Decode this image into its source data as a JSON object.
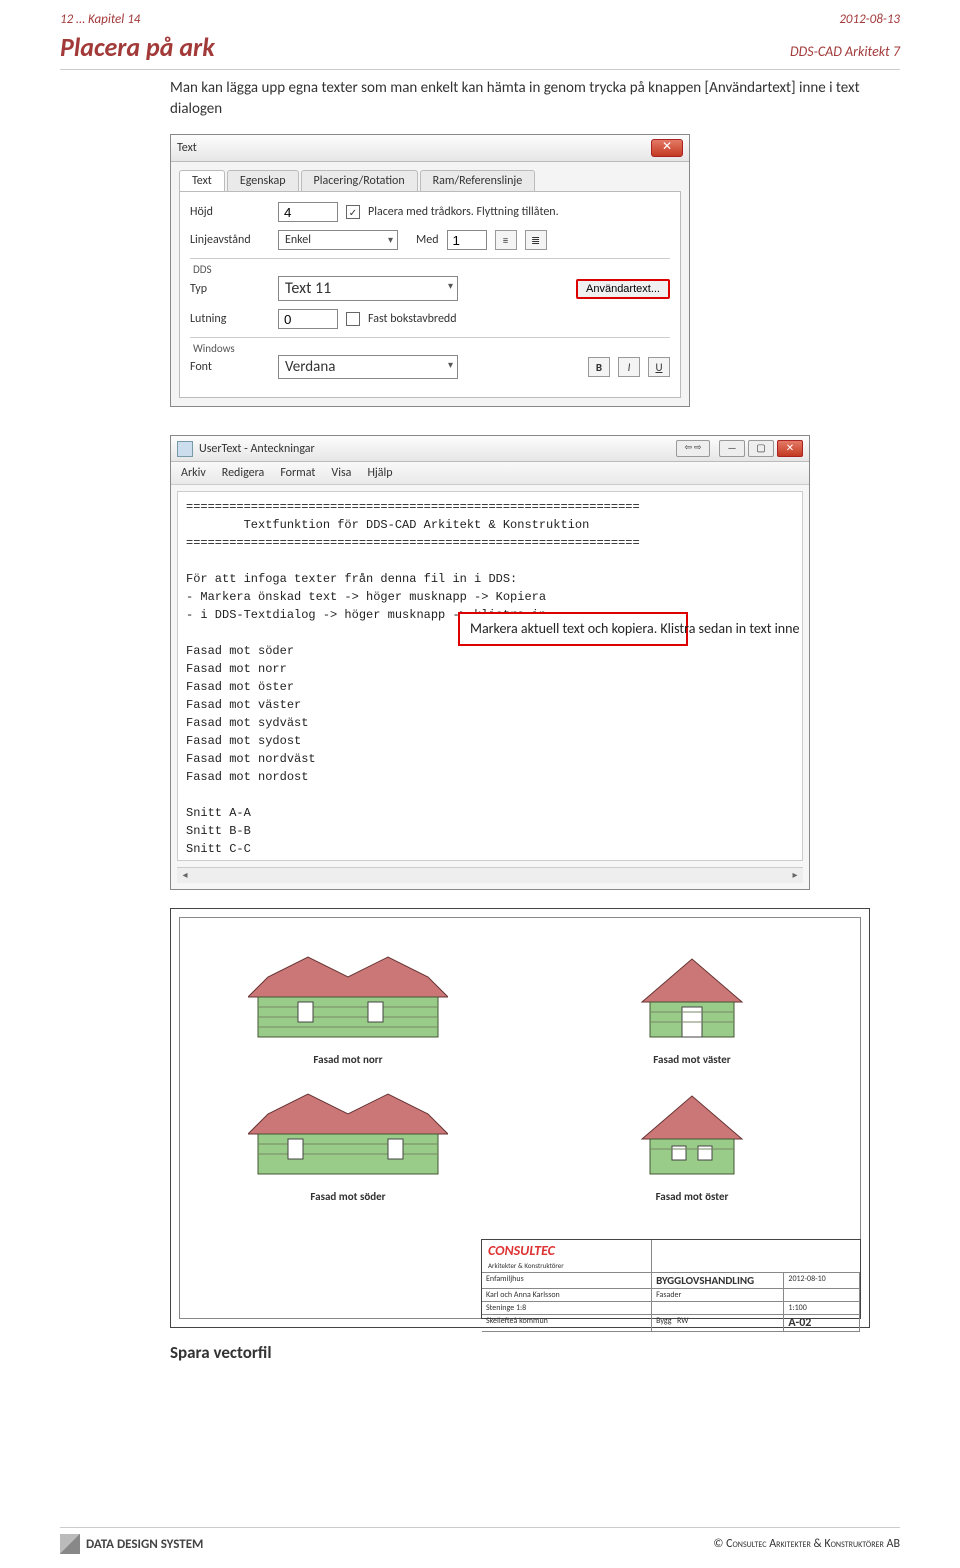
{
  "header": {
    "chapter": "12 … Kapitel 14",
    "date": "2012-08-13"
  },
  "title": {
    "main": "Placera på ark",
    "sub": "DDS-CAD Arkitekt 7"
  },
  "intro": "Man kan lägga upp egna texter som man enkelt kan hämta in genom trycka på knappen [Användartext] inne i text dialogen",
  "dialog1": {
    "title": "Text",
    "tabs": [
      "Text",
      "Egenskap",
      "Placering/Rotation",
      "Ram/Referenslinje"
    ],
    "hojd_label": "Höjd",
    "hojd_value": "4",
    "placera_chk": "Placera med trådkors. Flyttning tillåten.",
    "linje_label": "Linjeavstånd",
    "linje_value": "Enkel",
    "med_label": "Med",
    "med_value": "1",
    "dds_group": "DDS",
    "typ_label": "Typ",
    "typ_value": "Text 11",
    "anvandar_btn": "Användartext...",
    "lutning_label": "Lutning",
    "lutning_value": "0",
    "fast_chk": "Fast bokstavbredd",
    "win_group": "Windows",
    "font_label": "Font",
    "font_value": "Verdana",
    "b": "B",
    "i": "I",
    "u": "U"
  },
  "usertext": {
    "title": "UserText - Anteckningar",
    "menu": [
      "Arkiv",
      "Redigera",
      "Format",
      "Visa",
      "Hjälp"
    ],
    "content": "===============================================================\n        Textfunktion för DDS-CAD Arkitekt & Konstruktion\n===============================================================\n\nFör att infoga texter från denna fil in i DDS:\n- Markera önskad text -> höger musknapp -> Kopiera\n- i DDS-Textdialog -> höger musknapp -> klistra in\n\nFasad mot söder\nFasad mot norr\nFasad mot öster\nFasad mot väster\nFasad mot sydväst\nFasad mot sydost\nFasad mot nordväst\nFasad mot nordost\n\nSnitt A-A\nSnitt B-B\nSnitt C-C\nSnitt D-D\n\n=== Lägg in egna texter här under ============================"
  },
  "callout": "Markera aktuell text och kopiera. Klistra sedan in text inne i text dialogrutan.",
  "drawing": {
    "captions": [
      "Fasad mot norr",
      "Fasad mot väster",
      "Fasad mot söder",
      "Fasad mot öster"
    ],
    "titleblock": {
      "logo": "CONSULTEC",
      "logosub": "Arkitekter & Konstruktörer",
      "project1": "Enfamiljhus",
      "project2": "Karl och Anna Karlsson",
      "project3": "Steninge 1:8",
      "project4": "Skellefteå kommun",
      "main": "BYGGLOVSHANDLING",
      "sheet": "Fasader",
      "date": "2012-08-10",
      "scale": "1:100",
      "a": "A-02",
      "bygg": "Bygg",
      "rw": "RW"
    }
  },
  "spara": "Spara vectorfil",
  "footer": {
    "logo": "DATA DESIGN SYSTEM",
    "copy": "©  Consultec Arkitekter & Konstruktörer AB"
  }
}
